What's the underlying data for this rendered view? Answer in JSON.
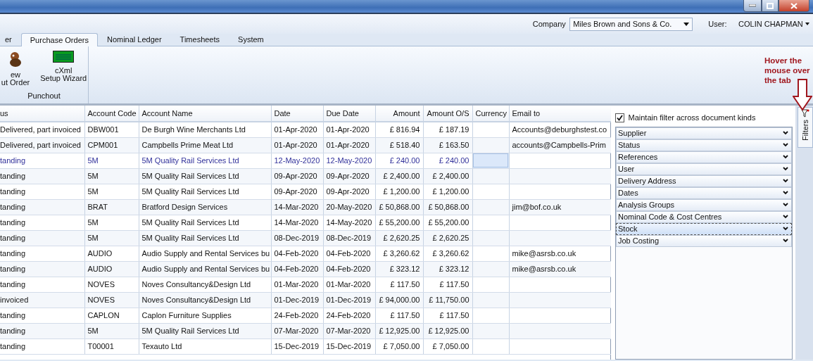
{
  "header": {
    "company_label": "Company",
    "company": "Miles Brown and Sons & Co.",
    "user_label": "User:",
    "user": "COLIN CHAPMAN"
  },
  "tabs": [
    {
      "label": "er",
      "selected": false
    },
    {
      "label": "Purchase Orders",
      "selected": true
    },
    {
      "label": "Nominal Ledger",
      "selected": false
    },
    {
      "label": "Timesheets",
      "selected": false
    },
    {
      "label": "System",
      "selected": false
    }
  ],
  "ribbon": {
    "groups": [
      {
        "label": "Punchout",
        "buttons": [
          {
            "kind": "figure",
            "lines": [
              "ew",
              "ut Order"
            ]
          },
          {
            "kind": "display",
            "lines": [
              "cXml",
              "Setup Wizard"
            ]
          }
        ]
      }
    ]
  },
  "annotation": "Hover the mouse over the tab",
  "table": {
    "columns": [
      {
        "label": "us",
        "kind": "text"
      },
      {
        "label": "Account Code",
        "kind": "text"
      },
      {
        "label": "Account Name",
        "kind": "text"
      },
      {
        "label": "Date",
        "kind": "text"
      },
      {
        "label": "Due Date",
        "kind": "text"
      },
      {
        "label": "Amount",
        "kind": "money"
      },
      {
        "label": "Amount O/S",
        "kind": "money"
      },
      {
        "label": "Currency",
        "kind": "text"
      },
      {
        "label": "Email to",
        "kind": "text"
      }
    ],
    "rows": [
      {
        "selected": false,
        "cells": [
          "Delivered, part invoiced",
          "DBW001",
          "De Burgh Wine Merchants Ltd",
          "01-Apr-2020",
          "01-Apr-2020",
          "£ 816.94",
          "£ 187.19",
          "",
          "Accounts@deburghstest.co"
        ]
      },
      {
        "selected": false,
        "cells": [
          "Delivered, part invoiced",
          "CPM001",
          "Campbells Prime Meat Ltd",
          "01-Apr-2020",
          "01-Apr-2020",
          "£ 518.40",
          "£ 163.50",
          "",
          "accounts@Campbells-Prim"
        ]
      },
      {
        "selected": true,
        "cells": [
          "tanding",
          "5M",
          "5M Quality Rail Services Ltd",
          "12-May-2020",
          "12-May-2020",
          "£ 240.00",
          "£ 240.00",
          "",
          ""
        ]
      },
      {
        "selected": false,
        "cells": [
          "tanding",
          "5M",
          "5M Quality Rail Services Ltd",
          "09-Apr-2020",
          "09-Apr-2020",
          "£ 2,400.00",
          "£ 2,400.00",
          "",
          ""
        ]
      },
      {
        "selected": false,
        "cells": [
          "tanding",
          "5M",
          "5M Quality Rail Services Ltd",
          "09-Apr-2020",
          "09-Apr-2020",
          "£ 1,200.00",
          "£ 1,200.00",
          "",
          ""
        ]
      },
      {
        "selected": false,
        "cells": [
          "tanding",
          "BRAT",
          "Bratford Design Services",
          "14-Mar-2020",
          "20-May-2020",
          "£ 50,868.00",
          "£ 50,868.00",
          "",
          "jim@bof.co.uk"
        ]
      },
      {
        "selected": false,
        "cells": [
          "tanding",
          "5M",
          "5M Quality Rail Services Ltd",
          "14-Mar-2020",
          "14-May-2020",
          "£ 55,200.00",
          "£ 55,200.00",
          "",
          ""
        ]
      },
      {
        "selected": false,
        "cells": [
          "tanding",
          "5M",
          "5M Quality Rail Services Ltd",
          "08-Dec-2019",
          "08-Dec-2019",
          "£ 2,620.25",
          "£ 2,620.25",
          "",
          ""
        ]
      },
      {
        "selected": false,
        "cells": [
          "tanding",
          "AUDIO",
          "Audio Supply and Rental Services bu",
          "04-Feb-2020",
          "04-Feb-2020",
          "£ 3,260.62",
          "£ 3,260.62",
          "",
          "mike@asrsb.co.uk"
        ]
      },
      {
        "selected": false,
        "cells": [
          "tanding",
          "AUDIO",
          "Audio Supply and Rental Services bu",
          "04-Feb-2020",
          "04-Feb-2020",
          "£ 323.12",
          "£ 323.12",
          "",
          "mike@asrsb.co.uk"
        ]
      },
      {
        "selected": false,
        "cells": [
          "tanding",
          "NOVES",
          "Noves Consultancy&Design Ltd",
          "01-Mar-2020",
          "01-Mar-2020",
          "£ 117.50",
          "£ 117.50",
          "",
          ""
        ]
      },
      {
        "selected": false,
        "cells": [
          "invoiced",
          "NOVES",
          "Noves Consultancy&Design Ltd",
          "01-Dec-2019",
          "01-Dec-2019",
          "£ 94,000.00",
          "£ 11,750.00",
          "",
          ""
        ]
      },
      {
        "selected": false,
        "cells": [
          "tanding",
          "CAPLON",
          "Caplon Furniture Supplies",
          "24-Feb-2020",
          "24-Feb-2020",
          "£ 117.50",
          "£ 117.50",
          "",
          ""
        ]
      },
      {
        "selected": false,
        "cells": [
          "tanding",
          "5M",
          "5M Quality Rail Services Ltd",
          "07-Mar-2020",
          "07-Mar-2020",
          "£ 12,925.00",
          "£ 12,925.00",
          "",
          ""
        ]
      },
      {
        "selected": false,
        "cells": [
          "tanding",
          "T00001",
          "Texauto Ltd",
          "15-Dec-2019",
          "15-Dec-2019",
          "£ 7,050.00",
          "£ 7,050.00",
          "",
          ""
        ]
      }
    ]
  },
  "filters": {
    "maintain": {
      "label": "Maintain filter across document kinds",
      "checked": true
    },
    "sections": [
      {
        "label": "Supplier",
        "selected": false
      },
      {
        "label": "Status",
        "selected": false
      },
      {
        "label": "References",
        "selected": false
      },
      {
        "label": "User",
        "selected": false
      },
      {
        "label": "Delivery Address",
        "selected": false
      },
      {
        "label": "Dates",
        "selected": false
      },
      {
        "label": "Analysis Groups",
        "selected": false
      },
      {
        "label": "Nominal Code & Cost Centres",
        "selected": false
      },
      {
        "label": "Stock",
        "selected": true
      },
      {
        "label": "Job Costing",
        "selected": false
      }
    ],
    "side_tab": "Filters"
  }
}
